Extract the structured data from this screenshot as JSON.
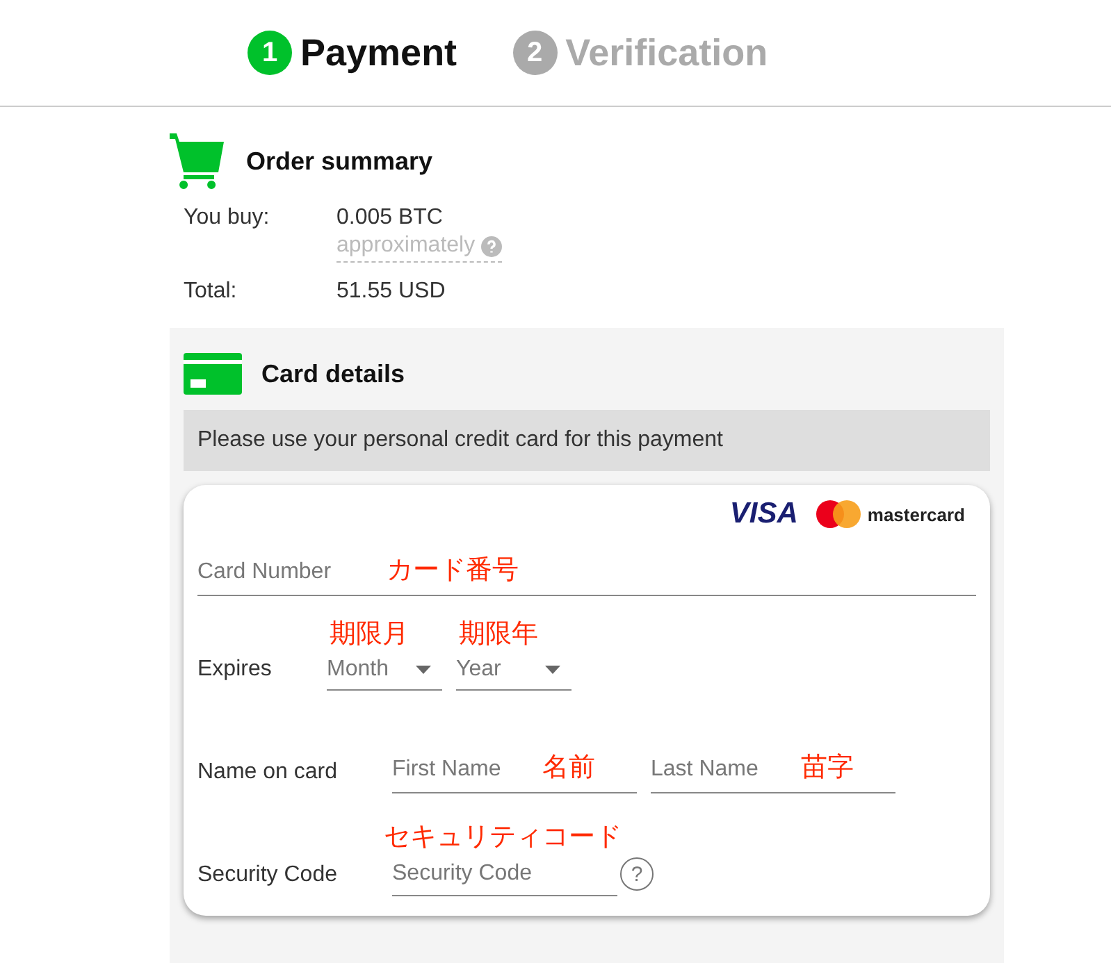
{
  "steps": [
    {
      "number": "1",
      "label": "Payment",
      "selected": true
    },
    {
      "number": "2",
      "label": "Verification",
      "selected": false
    }
  ],
  "order_summary": {
    "title": "Order summary",
    "rows": [
      {
        "label": "You buy:",
        "value": "0.005 BTC",
        "note": "approximately"
      },
      {
        "label": "Total:",
        "value": "51.55 USD"
      }
    ]
  },
  "card_details": {
    "title": "Card details",
    "notice": "Please use your personal credit card for this payment",
    "brands": [
      "VISA",
      "mastercard"
    ],
    "card_number": {
      "placeholder": "Card Number",
      "annotation": "カード番号"
    },
    "expires": {
      "label": "Expires",
      "selects": [
        {
          "placeholder": "Month",
          "annotation": "期限月"
        },
        {
          "placeholder": "Year",
          "annotation": "期限年"
        }
      ]
    },
    "name": {
      "label": "Name on card",
      "inputs": [
        {
          "placeholder": "First Name",
          "annotation": "名前"
        },
        {
          "placeholder": "Last Name",
          "annotation": "苗字"
        }
      ]
    },
    "security": {
      "label": "Security Code",
      "placeholder": "Security Code",
      "annotation": "セキュリティコード",
      "help": "?"
    }
  }
}
